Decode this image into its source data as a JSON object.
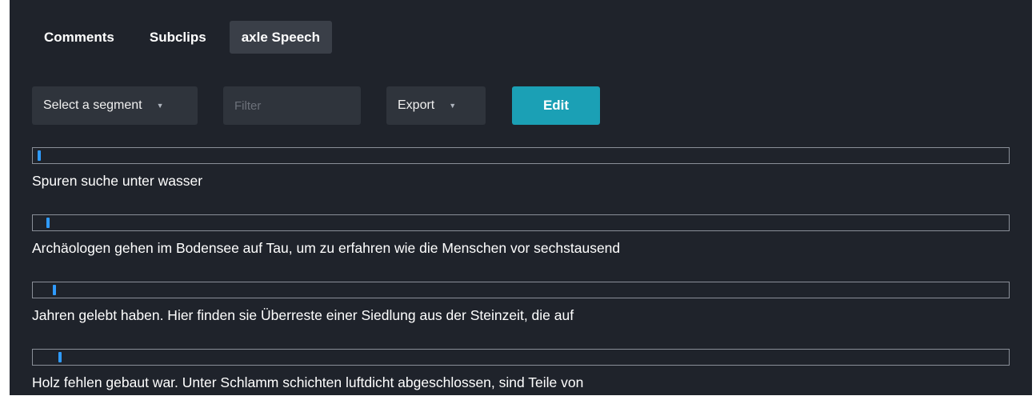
{
  "tabs": [
    {
      "label": "Comments",
      "active": false
    },
    {
      "label": "Subclips",
      "active": false
    },
    {
      "label": "axle Speech",
      "active": true
    }
  ],
  "toolbar": {
    "segment_select": "Select a segment",
    "filter_placeholder": "Filter",
    "filter_value": "",
    "export_select": "Export",
    "edit_label": "Edit",
    "caret": "▼"
  },
  "segments": [
    {
      "progress": 0.002,
      "text": "Spuren suche unter wasser"
    },
    {
      "progress": 0.011,
      "text": "Archäologen gehen im Bodensee auf Tau, um zu erfahren wie die Menschen vor sechstausend"
    },
    {
      "progress": 0.017,
      "text": "Jahren gelebt haben. Hier finden sie Überreste einer Siedlung aus der Steinzeit, die auf"
    },
    {
      "progress": 0.023,
      "text": "Holz fehlen gebaut war. Unter Schlamm schichten luftdicht abgeschlossen, sind Teile von"
    }
  ],
  "colors": {
    "panel_bg": "#1f232b",
    "tab_active_bg": "#3a3f48",
    "control_bg": "#2f343c",
    "accent": "#1ba0b5",
    "marker": "#2f9bff"
  }
}
